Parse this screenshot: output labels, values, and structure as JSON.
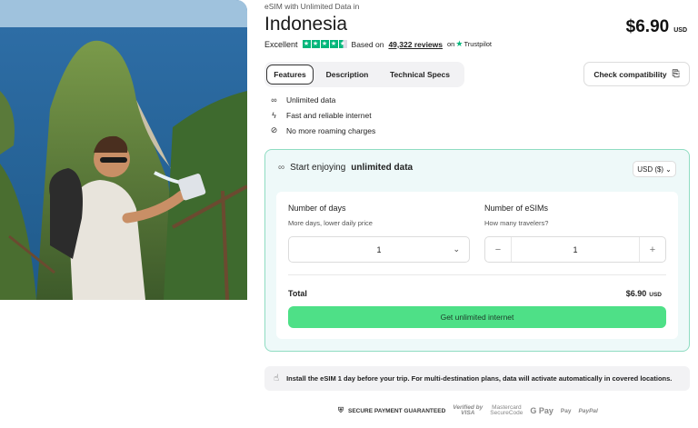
{
  "product": {
    "kicker": "eSIM with Unlimited Data in",
    "title": "Indonesia",
    "price": "$6.90",
    "price_currency": "USD"
  },
  "rating": {
    "label": "Excellent",
    "based_on": "Based on",
    "reviews": "49,322 reviews",
    "on": "on",
    "platform": "Trustpilot",
    "stars": 4.5
  },
  "tabs": [
    {
      "label": "Features",
      "active": true
    },
    {
      "label": "Description",
      "active": false
    },
    {
      "label": "Technical Specs",
      "active": false
    }
  ],
  "compat_button": {
    "label": "Check compatibility",
    "icon": "phone-check-icon"
  },
  "features": [
    {
      "icon": "infinity-icon",
      "label": "Unlimited data"
    },
    {
      "icon": "bolt-icon",
      "label": "Fast and reliable internet"
    },
    {
      "icon": "no-roaming-icon",
      "label": "No more roaming charges"
    }
  ],
  "purchase": {
    "heading_prefix": "Start enjoying",
    "heading_bold": "unlimited data",
    "currency_select": "USD ($)",
    "days_label": "Number of days",
    "days_sub": "More days, lower daily price",
    "days_value": "1",
    "esims_label": "Number of eSIMs",
    "esims_sub": "How many travelers?",
    "esims_value": "1",
    "minus": "−",
    "plus": "+",
    "total_label": "Total",
    "total_value": "$6.90",
    "total_currency": "USD",
    "cta": "Get unlimited internet"
  },
  "notice": {
    "text": "Install the eSIM 1 day before your trip. For multi-destination plans, data will activate automatically in covered locations."
  },
  "payment": {
    "secure": "SECURE PAYMENT GUARANTEED",
    "visa_line1": "Verified by",
    "visa_line2": "VISA",
    "mc_line1": "Mastercard",
    "mc_line2": "SecureCode",
    "gpay": "G Pay",
    "applepay": " Pay",
    "paypal": "PayPal"
  },
  "colors": {
    "accent_green": "#4ee087",
    "card_bg": "#eef9f9",
    "card_border": "#8fdcc2",
    "trustpilot_green": "#00b67a"
  }
}
